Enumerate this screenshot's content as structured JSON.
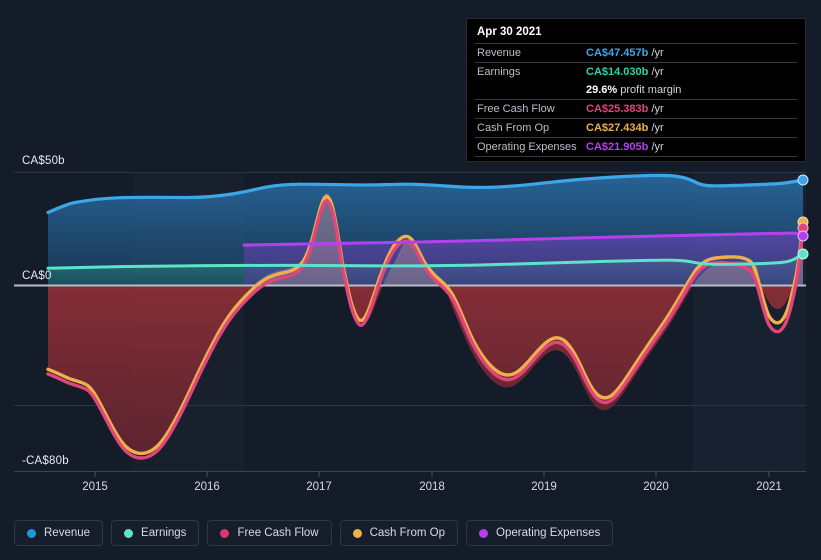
{
  "currency": "CA$",
  "colors": {
    "background": "#151c29",
    "revenue": "#3ea6e8",
    "earnings": "#5fe3c8",
    "free_cash_flow": "#e0457b",
    "cash_from_op": "#eeb04a",
    "operating_expenses": "#b341f0",
    "negative_fill": "#7e2b35",
    "gridline": "#2c3545",
    "zero_line": "#b8bec8",
    "axis_text": "#e6eaf0"
  },
  "tooltip": {
    "date": "Apr 30 2021",
    "rows": [
      {
        "name": "Revenue",
        "value": "CA$47.457b",
        "unit": "/yr",
        "color": "#3ea6e8"
      },
      {
        "name": "Earnings",
        "value": "CA$14.030b",
        "unit": "/yr",
        "color": "#2fd4a8"
      },
      {
        "name": "",
        "value": "29.6%",
        "unit": "profit margin",
        "color": "#ffffff"
      },
      {
        "name": "Free Cash Flow",
        "value": "CA$25.383b",
        "unit": "/yr",
        "color": "#e0457b"
      },
      {
        "name": "Cash From Op",
        "value": "CA$27.434b",
        "unit": "/yr",
        "color": "#eeb04a"
      },
      {
        "name": "Operating Expenses",
        "value": "CA$21.905b",
        "unit": "/yr",
        "color": "#b341f0"
      }
    ]
  },
  "legend": {
    "items": [
      {
        "label": "Revenue",
        "color": "#2196d8"
      },
      {
        "label": "Earnings",
        "color": "#5fe3c8"
      },
      {
        "label": "Free Cash Flow",
        "color": "#d63a6e"
      },
      {
        "label": "Cash From Op",
        "color": "#eeb04a"
      },
      {
        "label": "Operating Expenses",
        "color": "#b341f0"
      }
    ]
  },
  "chart_data": {
    "type": "area",
    "title": "",
    "xlabel": "",
    "ylabel": "",
    "currency": "CA$",
    "unit": "billions",
    "grid": true,
    "legend_position": "bottom",
    "y_ticks": [
      {
        "label": "CA$50b",
        "value": 50
      },
      {
        "label": "CA$0",
        "value": 0
      },
      {
        "label": "-CA$80b",
        "value": -80
      }
    ],
    "ylim": [
      -80,
      50
    ],
    "x_ticks": [
      "2015",
      "2016",
      "2017",
      "2018",
      "2019",
      "2020",
      "2021"
    ],
    "xlim": [
      2014.58,
      2021.33
    ],
    "series": [
      {
        "name": "Revenue",
        "color": "#3ea6e8",
        "x": [
          2014.58,
          2014.85,
          2015.1,
          2015.4,
          2015.7,
          2016.0,
          2016.3,
          2016.6,
          2016.9,
          2017.0,
          2017.2,
          2017.5,
          2017.8,
          2018.0,
          2018.3,
          2018.6,
          2018.9,
          2019.2,
          2019.5,
          2019.8,
          2020.0,
          2020.15,
          2020.4,
          2020.7,
          2021.0,
          2021.33
        ],
        "values": [
          32.3,
          33.5,
          34.6,
          35.1,
          35.0,
          35.0,
          35.2,
          35.8,
          37.0,
          37.6,
          37.6,
          37.5,
          37.6,
          37.7,
          38.4,
          39.3,
          40.4,
          41.3,
          42.2,
          43.6,
          44.0,
          42.6,
          42.8,
          43.0,
          43.8,
          47.457
        ]
      },
      {
        "name": "Earnings",
        "color": "#5fe3c8",
        "x": [
          2014.58,
          2015.2,
          2015.8,
          2016.4,
          2017.0,
          2017.6,
          2018.2,
          2018.8,
          2019.4,
          2020.0,
          2020.3,
          2020.8,
          2021.0,
          2021.33
        ],
        "values": [
          7.3,
          7.6,
          7.9,
          8.2,
          8.5,
          8.4,
          8.5,
          8.9,
          9.6,
          10.3,
          9.6,
          9.8,
          10.3,
          14.03
        ]
      },
      {
        "name": "Free Cash Flow",
        "color": "#e0457b",
        "x": [
          2014.58,
          2014.9,
          2015.1,
          2015.35,
          2015.55,
          2015.75,
          2015.95,
          2016.15,
          2016.4,
          2016.65,
          2016.85,
          2016.95,
          2017.05,
          2017.15,
          2017.3,
          2017.45,
          2017.6,
          2017.75,
          2017.9,
          2018.1,
          2018.35,
          2018.6,
          2018.9,
          2019.1,
          2019.3,
          2019.5,
          2019.7,
          2019.9,
          2020.05,
          2020.3,
          2020.5,
          2020.75,
          2021.0,
          2021.15,
          2021.33
        ],
        "values": [
          -38.5,
          -40.0,
          -45.0,
          -56.0,
          -62.0,
          -61.0,
          -53.0,
          -36.0,
          -14.0,
          3.0,
          22.0,
          38.0,
          29.0,
          4.0,
          -9.5,
          3.0,
          14.5,
          11.0,
          7.0,
          3.0,
          -9.0,
          -20.0,
          -30.0,
          -26.0,
          -32.0,
          -43.0,
          -53.0,
          -44.0,
          -32.0,
          -19.0,
          5.0,
          8.0,
          -1.5,
          8.0,
          25.383
        ]
      },
      {
        "name": "Cash From Op",
        "color": "#eeb04a",
        "x": [
          2014.58,
          2014.9,
          2015.1,
          2015.35,
          2015.55,
          2015.75,
          2015.95,
          2016.15,
          2016.4,
          2016.65,
          2016.85,
          2016.95,
          2017.05,
          2017.15,
          2017.3,
          2017.45,
          2017.6,
          2017.75,
          2017.9,
          2018.1,
          2018.35,
          2018.6,
          2018.9,
          2019.1,
          2019.3,
          2019.5,
          2019.7,
          2019.9,
          2020.05,
          2020.3,
          2020.5,
          2020.75,
          2021.0,
          2021.15,
          2021.33
        ],
        "values": [
          -36.5,
          -38.0,
          -43.0,
          -53.5,
          -59.5,
          -58.5,
          -50.5,
          -33.5,
          -11.5,
          5.5,
          24.5,
          40.5,
          31.5,
          6.5,
          -7.0,
          5.5,
          17.0,
          13.5,
          9.5,
          5.5,
          -6.5,
          -17.5,
          -27.5,
          -23.5,
          -29.5,
          -40.5,
          -50.5,
          -41.5,
          -29.5,
          -16.5,
          8.5,
          11.5,
          2.0,
          11.0,
          27.434
        ]
      },
      {
        "name": "Operating Expenses",
        "color": "#b341f0",
        "x": [
          2016.33,
          2016.8,
          2017.3,
          2017.8,
          2018.3,
          2018.8,
          2019.3,
          2019.8,
          2020.3,
          2020.8,
          2021.33
        ],
        "values": [
          17.3,
          17.6,
          17.9,
          18.1,
          18.4,
          18.8,
          19.3,
          19.8,
          20.3,
          20.9,
          21.905
        ]
      }
    ]
  }
}
